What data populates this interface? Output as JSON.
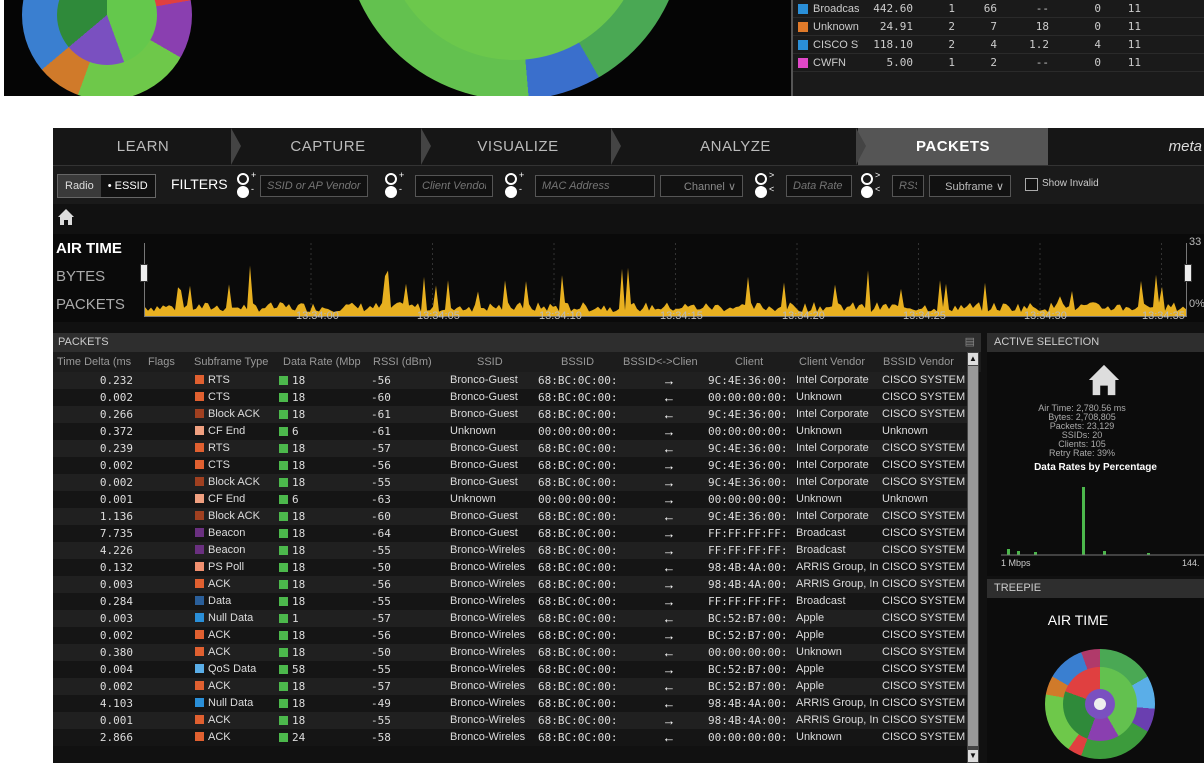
{
  "top_table": [
    {
      "color": "#2a8fd8",
      "name": "Broadcas",
      "v1": "442.60",
      "v2": "1",
      "v3": "66",
      "v4": "--",
      "v5": "0",
      "v6": "11"
    },
    {
      "color": "#e07a2a",
      "name": "Unknown",
      "v1": "24.91",
      "v2": "2",
      "v3": "7",
      "v4": "18",
      "v5": "0",
      "v6": "11"
    },
    {
      "color": "#2a8fd8",
      "name": "CISCO SY",
      "v1": "118.10",
      "v2": "2",
      "v3": "4",
      "v4": "1.2",
      "v5": "4",
      "v6": "11"
    },
    {
      "color": "#e048c8",
      "name": "CWFN",
      "v1": "5.00",
      "v2": "1",
      "v3": "2",
      "v4": "--",
      "v5": "0",
      "v6": "11"
    }
  ],
  "nav": {
    "tabs": [
      {
        "label": "LEARN",
        "active": false
      },
      {
        "label": "CAPTURE",
        "active": false
      },
      {
        "label": "VISUALIZE",
        "active": false
      },
      {
        "label": "ANALYZE",
        "active": false
      },
      {
        "label": "PACKETS",
        "active": true
      }
    ],
    "brand": "meta"
  },
  "filters": {
    "toggle_radio": "Radio",
    "toggle_essid": "• ESSID",
    "label": "FILTERS",
    "ssid_placeholder": "SSID or AP Vendor",
    "client_placeholder": "Client Vendor",
    "mac_placeholder": "MAC Address",
    "channel": "Channel",
    "data_rate_placeholder": "Data Rate",
    "rssi_placeholder": "RSSI",
    "subframe": "Subframe",
    "show_invalid": "Show Invalid",
    "plus": "+",
    "minus": "-",
    "gt": ">",
    "lt": "<"
  },
  "timeline": {
    "labels": [
      "AIR TIME",
      "BYTES",
      "PACKETS"
    ],
    "ticks": [
      "13:34:00",
      "13:34:05",
      "13:34:10",
      "13:34:15",
      "13:34:20",
      "13:34:25",
      "13:34:30",
      "13:34:35"
    ],
    "ymax": "33",
    "ymin": "0%",
    "fill_color": "#e8b020"
  },
  "packets": {
    "title": "PACKETS",
    "columns": [
      "Time Delta (ms",
      "Flags",
      "Subframe Type",
      "Data Rate (Mbp",
      "RSSI (dBm)",
      "SSID",
      "BSSID",
      "BSSID<->Clien",
      "Client",
      "Client Vendor",
      "BSSID Vendor"
    ],
    "rows": [
      {
        "td": "0.232",
        "st": "RTS",
        "stc": "#e06030",
        "dr": "18",
        "rssi": "-56",
        "ssid": "Bronco-Guest",
        "bssid": "68:BC:0C:00:",
        "dir": "→",
        "client": "9C:4E:36:00:",
        "cv": "Intel Corporate",
        "bv": "CISCO SYSTEM"
      },
      {
        "td": "0.002",
        "st": "CTS",
        "stc": "#e06030",
        "dr": "18",
        "rssi": "-60",
        "ssid": "Bronco-Guest",
        "bssid": "68:BC:0C:00:",
        "dir": "←",
        "client": "00:00:00:00:",
        "cv": "Unknown",
        "bv": "CISCO SYSTEM"
      },
      {
        "td": "0.266",
        "st": "Block ACK",
        "stc": "#a04020",
        "dr": "18",
        "rssi": "-61",
        "ssid": "Bronco-Guest",
        "bssid": "68:BC:0C:00:",
        "dir": "←",
        "client": "9C:4E:36:00:",
        "cv": "Intel Corporate",
        "bv": "CISCO SYSTEM"
      },
      {
        "td": "0.372",
        "st": "CF End",
        "stc": "#f0a080",
        "dr": "6",
        "rssi": "-61",
        "ssid": "Unknown",
        "bssid": "00:00:00:00:",
        "dir": "→",
        "client": "00:00:00:00:",
        "cv": "Unknown",
        "bv": "Unknown"
      },
      {
        "td": "0.239",
        "st": "RTS",
        "stc": "#e06030",
        "dr": "18",
        "rssi": "-57",
        "ssid": "Bronco-Guest",
        "bssid": "68:BC:0C:00:",
        "dir": "←",
        "client": "9C:4E:36:00:",
        "cv": "Intel Corporate",
        "bv": "CISCO SYSTEM"
      },
      {
        "td": "0.002",
        "st": "CTS",
        "stc": "#e06030",
        "dr": "18",
        "rssi": "-56",
        "ssid": "Bronco-Guest",
        "bssid": "68:BC:0C:00:",
        "dir": "→",
        "client": "9C:4E:36:00:",
        "cv": "Intel Corporate",
        "bv": "CISCO SYSTEM"
      },
      {
        "td": "0.002",
        "st": "Block ACK",
        "stc": "#a04020",
        "dr": "18",
        "rssi": "-55",
        "ssid": "Bronco-Guest",
        "bssid": "68:BC:0C:00:",
        "dir": "→",
        "client": "9C:4E:36:00:",
        "cv": "Intel Corporate",
        "bv": "CISCO SYSTEM"
      },
      {
        "td": "0.001",
        "st": "CF End",
        "stc": "#f0a080",
        "dr": "6",
        "rssi": "-63",
        "ssid": "Unknown",
        "bssid": "00:00:00:00:",
        "dir": "→",
        "client": "00:00:00:00:",
        "cv": "Unknown",
        "bv": "Unknown"
      },
      {
        "td": "1.136",
        "st": "Block ACK",
        "stc": "#a04020",
        "dr": "18",
        "rssi": "-60",
        "ssid": "Bronco-Guest",
        "bssid": "68:BC:0C:00:",
        "dir": "←",
        "client": "9C:4E:36:00:",
        "cv": "Intel Corporate",
        "bv": "CISCO SYSTEM"
      },
      {
        "td": "7.735",
        "st": "Beacon",
        "stc": "#6a3080",
        "dr": "18",
        "rssi": "-64",
        "ssid": "Bronco-Guest",
        "bssid": "68:BC:0C:00:",
        "dir": "→",
        "client": "FF:FF:FF:FF:",
        "cv": "Broadcast",
        "bv": "CISCO SYSTEM"
      },
      {
        "td": "4.226",
        "st": "Beacon",
        "stc": "#6a3080",
        "dr": "18",
        "rssi": "-55",
        "ssid": "Bronco-Wireles",
        "bssid": "68:BC:0C:00:",
        "dir": "→",
        "client": "FF:FF:FF:FF:",
        "cv": "Broadcast",
        "bv": "CISCO SYSTEM"
      },
      {
        "td": "0.132",
        "st": "PS Poll",
        "stc": "#f09070",
        "dr": "18",
        "rssi": "-50",
        "ssid": "Bronco-Wireles",
        "bssid": "68:BC:0C:00:",
        "dir": "←",
        "client": "98:4B:4A:00:",
        "cv": "ARRIS Group, In",
        "bv": "CISCO SYSTEM"
      },
      {
        "td": "0.003",
        "st": "ACK",
        "stc": "#e06030",
        "dr": "18",
        "rssi": "-56",
        "ssid": "Bronco-Wireles",
        "bssid": "68:BC:0C:00:",
        "dir": "→",
        "client": "98:4B:4A:00:",
        "cv": "ARRIS Group, In",
        "bv": "CISCO SYSTEM"
      },
      {
        "td": "0.284",
        "st": "Data",
        "stc": "#2a5f9a",
        "dr": "18",
        "rssi": "-55",
        "ssid": "Bronco-Wireles",
        "bssid": "68:BC:0C:00:",
        "dir": "→",
        "client": "FF:FF:FF:FF:",
        "cv": "Broadcast",
        "bv": "CISCO SYSTEM"
      },
      {
        "td": "0.003",
        "st": "Null Data",
        "stc": "#2a8fd8",
        "dr": "1",
        "rssi": "-57",
        "ssid": "Bronco-Wireles",
        "bssid": "68:BC:0C:00:",
        "dir": "←",
        "client": "BC:52:B7:00:",
        "cv": "Apple",
        "bv": "CISCO SYSTEM"
      },
      {
        "td": "0.002",
        "st": "ACK",
        "stc": "#e06030",
        "dr": "18",
        "rssi": "-56",
        "ssid": "Bronco-Wireles",
        "bssid": "68:BC:0C:00:",
        "dir": "→",
        "client": "BC:52:B7:00:",
        "cv": "Apple",
        "bv": "CISCO SYSTEM"
      },
      {
        "td": "0.380",
        "st": "ACK",
        "stc": "#e06030",
        "dr": "18",
        "rssi": "-50",
        "ssid": "Bronco-Wireles",
        "bssid": "68:BC:0C:00:",
        "dir": "←",
        "client": "00:00:00:00:",
        "cv": "Unknown",
        "bv": "CISCO SYSTEM"
      },
      {
        "td": "0.004",
        "st": "QoS Data",
        "stc": "#5aaee8",
        "dr": "58",
        "rssi": "-55",
        "ssid": "Bronco-Wireles",
        "bssid": "68:BC:0C:00:",
        "dir": "→",
        "client": "BC:52:B7:00:",
        "cv": "Apple",
        "bv": "CISCO SYSTEM"
      },
      {
        "td": "0.002",
        "st": "ACK",
        "stc": "#e06030",
        "dr": "18",
        "rssi": "-57",
        "ssid": "Bronco-Wireles",
        "bssid": "68:BC:0C:00:",
        "dir": "←",
        "client": "BC:52:B7:00:",
        "cv": "Apple",
        "bv": "CISCO SYSTEM"
      },
      {
        "td": "4.103",
        "st": "Null Data",
        "stc": "#2a8fd8",
        "dr": "18",
        "rssi": "-49",
        "ssid": "Bronco-Wireles",
        "bssid": "68:BC:0C:00:",
        "dir": "←",
        "client": "98:4B:4A:00:",
        "cv": "ARRIS Group, In",
        "bv": "CISCO SYSTEM"
      },
      {
        "td": "0.001",
        "st": "ACK",
        "stc": "#e06030",
        "dr": "18",
        "rssi": "-55",
        "ssid": "Bronco-Wireles",
        "bssid": "68:BC:0C:00:",
        "dir": "→",
        "client": "98:4B:4A:00:",
        "cv": "ARRIS Group, In",
        "bv": "CISCO SYSTEM"
      },
      {
        "td": "2.866",
        "st": "ACK",
        "stc": "#e06030",
        "dr": "24",
        "rssi": "-58",
        "ssid": "Bronco-Wireles",
        "bssid": "68:BC:0C:00:",
        "dir": "←",
        "client": "00:00:00:00:",
        "cv": "Unknown",
        "bv": "CISCO SYSTEM"
      }
    ]
  },
  "active_selection": {
    "title": "ACTIVE SELECTION",
    "air_time": "Air Time: 2,780.56 ms",
    "bytes": "Bytes: 2,708,805",
    "packets": "Packets: 23,129",
    "ssids": "SSIDs: 20",
    "clients": "Clients: 105",
    "retry_rate": "Retry Rate: 39%",
    "chart_title": "Data Rates by Percentage",
    "x_min": "1 Mbps",
    "x_max": "144."
  },
  "treepie": {
    "title": "TREEPIE",
    "subtitle": "AIR TIME"
  },
  "colors": {
    "accent": "#e8b020",
    "rate_green": "#4cb84c"
  }
}
